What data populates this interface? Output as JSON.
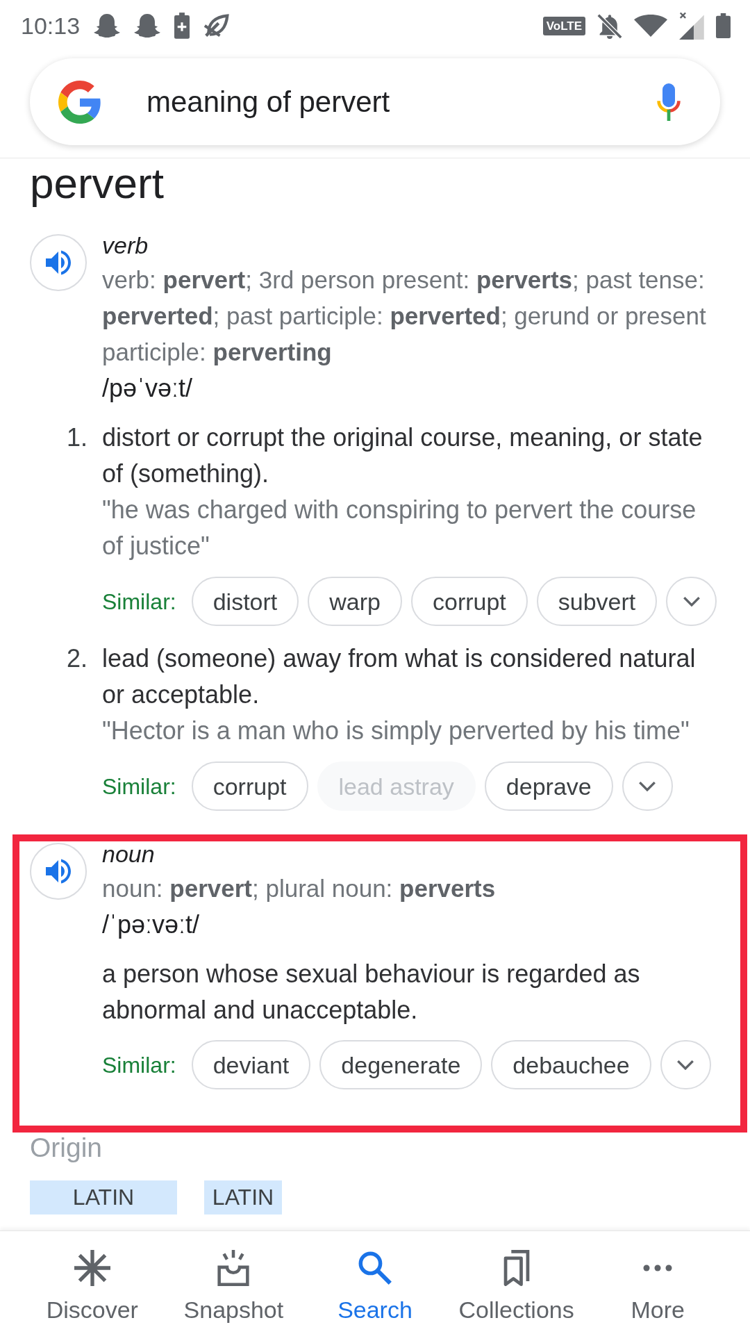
{
  "status_bar": {
    "time": "10:13",
    "network_badge": "VoLTE"
  },
  "search_bar": {
    "query": "meaning of pervert"
  },
  "entry": {
    "headword": "pervert",
    "sections": [
      {
        "part_of_speech": "verb",
        "forms": "verb: **pervert**; 3rd person present: **perverts**; past tense: **perverted**; past participle: **perverted**; gerund or present participle: **perverting**",
        "phonetic": "/pəˈvəːt/",
        "highlighted": false,
        "senses": [
          {
            "number": "1.",
            "definition": "distort or corrupt the original course, meaning, or state of (something).",
            "example": "\"he was charged with conspiring to pervert the course of justice\"",
            "similar": {
              "label": "Similar:",
              "chips": [
                {
                  "label": "distort",
                  "disabled": false
                },
                {
                  "label": "warp",
                  "disabled": false
                },
                {
                  "label": "corrupt",
                  "disabled": false
                },
                {
                  "label": "subvert",
                  "disabled": false
                }
              ]
            }
          },
          {
            "number": "2.",
            "definition": "lead (someone) away from what is considered natural or acceptable.",
            "example": "\"Hector is a man who is simply perverted by his time\"",
            "similar": {
              "label": "Similar:",
              "chips": [
                {
                  "label": "corrupt",
                  "disabled": false
                },
                {
                  "label": "lead astray",
                  "disabled": true
                },
                {
                  "label": "deprave",
                  "disabled": false
                }
              ]
            }
          }
        ]
      },
      {
        "part_of_speech": "noun",
        "forms": "noun: **pervert**; plural noun: **perverts**",
        "phonetic": "/ˈpəːvəːt/",
        "highlighted": true,
        "senses": [
          {
            "definition": "a person whose sexual behaviour is regarded as abnormal and unacceptable.",
            "similar": {
              "label": "Similar:",
              "chips": [
                {
                  "label": "deviant",
                  "disabled": false
                },
                {
                  "label": "degenerate",
                  "disabled": false
                },
                {
                  "label": "debauchee",
                  "disabled": false
                }
              ]
            }
          }
        ]
      }
    ]
  },
  "origin": {
    "title": "Origin",
    "languages": [
      "LATIN",
      "LATIN"
    ]
  },
  "bottom_nav": [
    {
      "label": "Discover",
      "selected": false
    },
    {
      "label": "Snapshot",
      "selected": false
    },
    {
      "label": "Search",
      "selected": true
    },
    {
      "label": "Collections",
      "selected": false
    },
    {
      "label": "More",
      "selected": false
    }
  ]
}
